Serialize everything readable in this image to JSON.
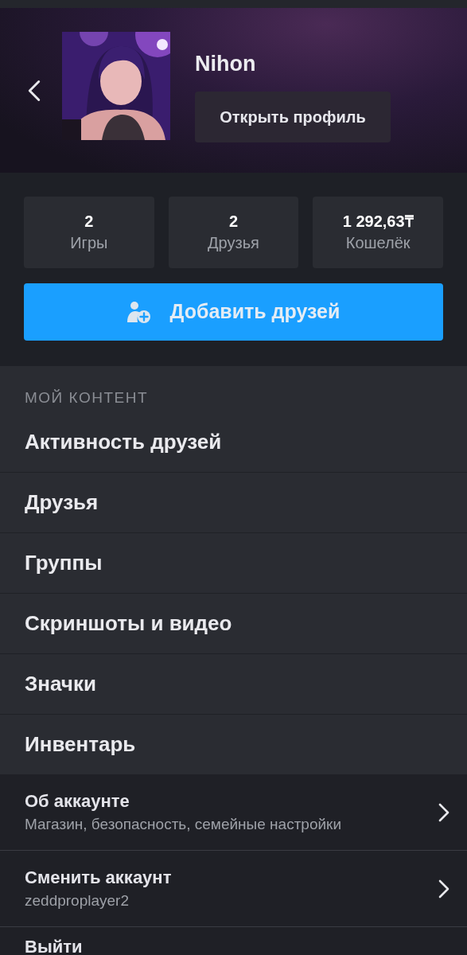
{
  "header": {
    "name": "Nihon",
    "open_profile_button": "Открыть профиль"
  },
  "stats": [
    {
      "value": "2",
      "label": "Игры"
    },
    {
      "value": "2",
      "label": "Друзья"
    },
    {
      "value": "1 292,63₸",
      "label": "Кошелёк"
    }
  ],
  "add_friends_button": "Добавить друзей",
  "my_content": {
    "heading": "МОЙ КОНТЕНТ",
    "items": [
      "Активность друзей",
      "Друзья",
      "Группы",
      "Скриншоты и видео",
      "Значки",
      "Инвентарь"
    ]
  },
  "account_items": [
    {
      "title": "Об аккаунте",
      "subtitle": "Магазин, безопасность, семейные настройки"
    },
    {
      "title": "Сменить аккаунт",
      "subtitle": "zeddproplayer2"
    }
  ],
  "logout": "Выйти"
}
